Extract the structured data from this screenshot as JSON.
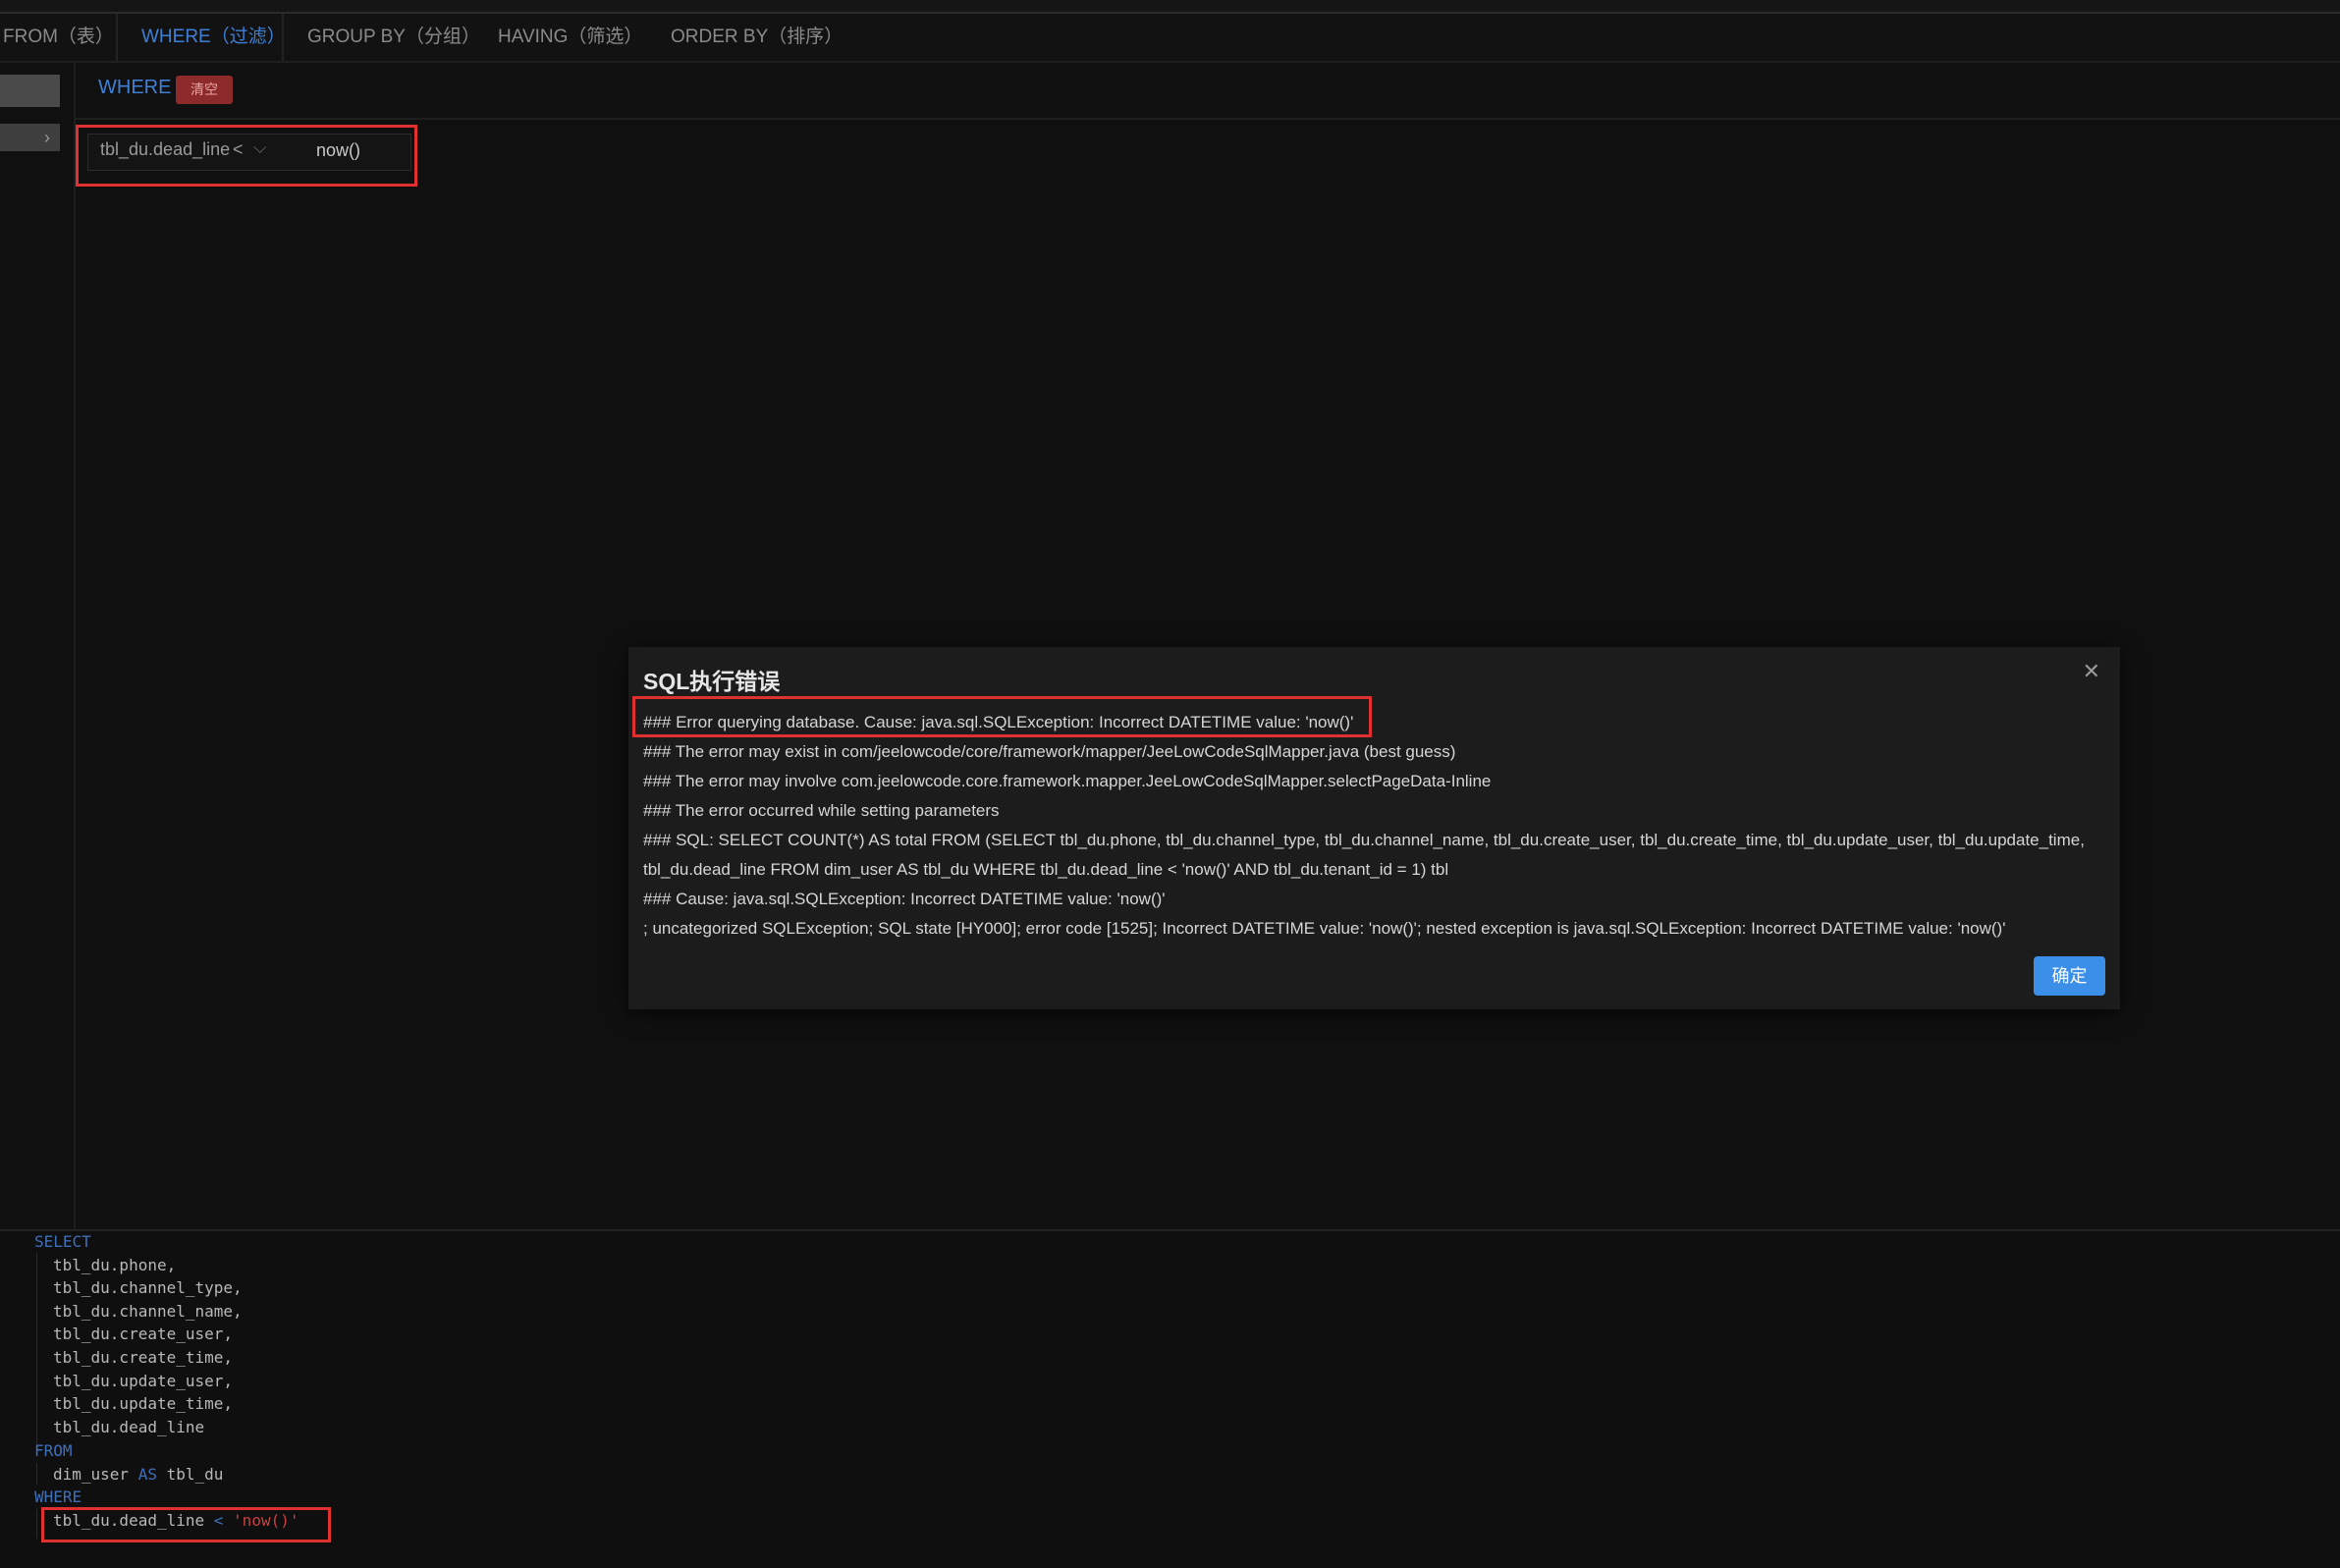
{
  "tabs": [
    {
      "label": "FROM（表）"
    },
    {
      "label": "WHERE（过滤）"
    },
    {
      "label": "GROUP BY（分组）"
    },
    {
      "label": "HAVING（筛选）"
    },
    {
      "label": "ORDER BY（排序）"
    }
  ],
  "where_panel": {
    "title": "WHERE",
    "clear_label": "清空",
    "condition": {
      "field": "tbl_du.dead_line",
      "operator": "<",
      "value": "now()"
    }
  },
  "modal": {
    "title": "SQL执行错误",
    "lines": [
      "### Error querying database.  Cause: java.sql.SQLException: Incorrect DATETIME value: 'now()'",
      "### The error may exist in com/jeelowcode/core/framework/mapper/JeeLowCodeSqlMapper.java (best guess)",
      "### The error may involve com.jeelowcode.core.framework.mapper.JeeLowCodeSqlMapper.selectPageData-Inline",
      "### The error occurred while setting parameters",
      "### SQL: SELECT COUNT(*) AS total FROM (SELECT tbl_du.phone, tbl_du.channel_type, tbl_du.channel_name, tbl_du.create_user, tbl_du.create_time, tbl_du.update_user, tbl_du.update_time,",
      "tbl_du.dead_line FROM dim_user AS tbl_du WHERE tbl_du.dead_line < 'now()' AND tbl_du.tenant_id = 1) tbl",
      "### Cause: java.sql.SQLException: Incorrect DATETIME value: 'now()'",
      "; uncategorized SQLException; SQL state [HY000]; error code [1525]; Incorrect DATETIME value: 'now()'; nested exception is java.sql.SQLException: Incorrect DATETIME value: 'now()'"
    ],
    "ok_label": "确定"
  },
  "sql_preview": {
    "select_kw": "SELECT",
    "columns": [
      "tbl_du.phone,",
      "tbl_du.channel_type,",
      "tbl_du.channel_name,",
      "tbl_du.create_user,",
      "tbl_du.create_time,",
      "tbl_du.update_user,",
      "tbl_du.update_time,",
      "tbl_du.dead_line"
    ],
    "from_kw": "FROM",
    "table": "dim_user",
    "as_kw": "AS",
    "alias": "tbl_du",
    "where_kw": "WHERE",
    "where_field": "tbl_du.dead_line",
    "where_op": "<",
    "where_value": "'now()'"
  },
  "colors": {
    "accent": "#3f7fd6",
    "danger": "#e03030",
    "primary_button": "#3b8fe8"
  }
}
